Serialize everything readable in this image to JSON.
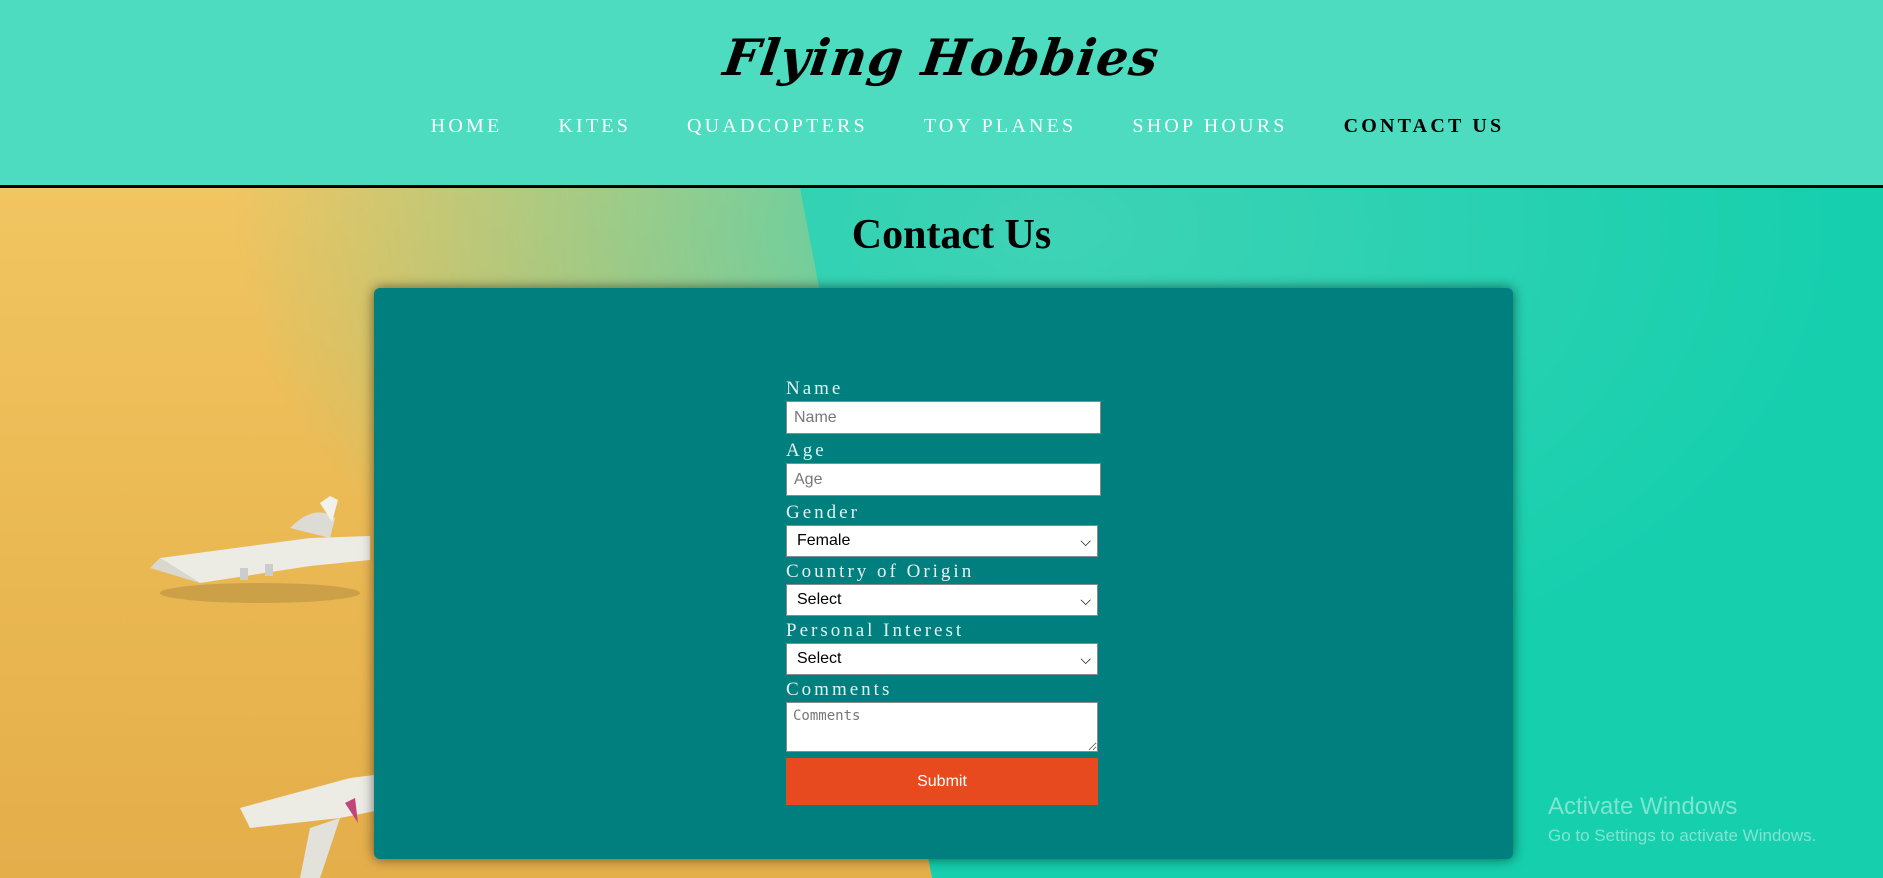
{
  "site": {
    "logo": "Flying Hobbies"
  },
  "nav": {
    "items": [
      {
        "label": "HOME"
      },
      {
        "label": "KITES"
      },
      {
        "label": "QUADCOPTERS"
      },
      {
        "label": "TOY PLANES"
      },
      {
        "label": "SHOP HOURS"
      },
      {
        "label": "CONTACT US"
      }
    ],
    "active_index": 5
  },
  "page": {
    "title": "Contact Us"
  },
  "form": {
    "name_label": "Name",
    "name_placeholder": "Name",
    "age_label": "Age",
    "age_placeholder": "Age",
    "gender_label": "Gender",
    "gender_value": "Female",
    "country_label": "Country of Origin",
    "country_value": "Select",
    "interest_label": "Personal Interest",
    "interest_value": "Select",
    "comments_label": "Comments",
    "comments_placeholder": "Comments",
    "submit_label": "Submit"
  },
  "watermark": {
    "line1": "Activate Windows",
    "line2": "Go to Settings to activate Windows."
  },
  "colors": {
    "header_bg": "#4ddcbf",
    "card_bg": "#007f7f",
    "submit_bg": "#e84a1f",
    "hero_yellow": "#f1c561",
    "hero_teal": "#15cfad"
  }
}
